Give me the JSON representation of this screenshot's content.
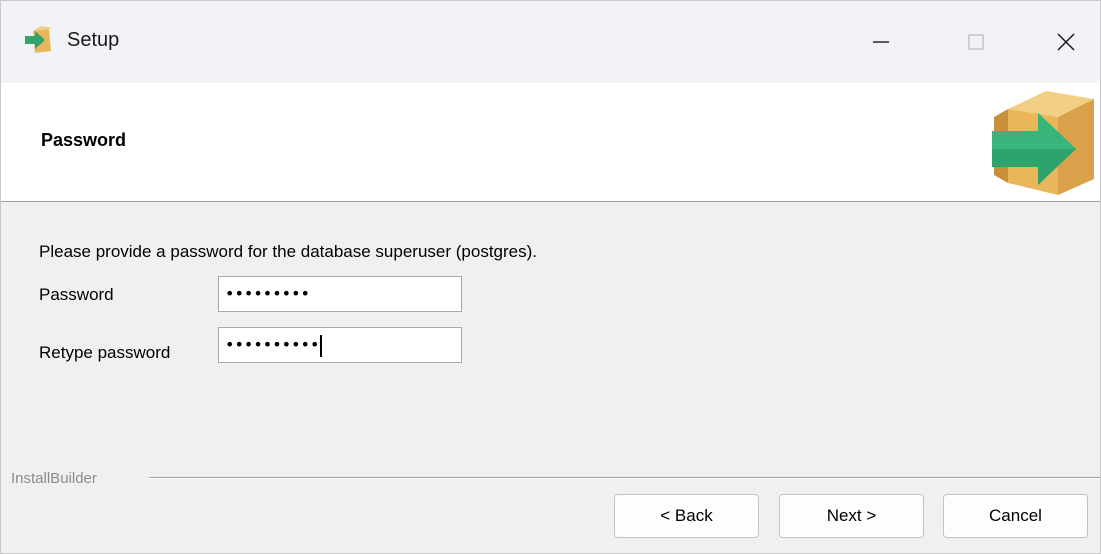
{
  "window": {
    "title": "Setup",
    "icon": "installer-box-arrow-icon",
    "controls": {
      "minimize": "minimize-icon",
      "maximize": "maximize-icon",
      "close": "close-icon"
    }
  },
  "header": {
    "title": "Password",
    "logo": "installer-box-arrow-icon"
  },
  "body": {
    "intro": "Please provide a password for the database superuser (postgres).",
    "password_label": "Password",
    "password_value": "•••••••••",
    "retype_label": "Retype password",
    "retype_value": "••••••••••"
  },
  "footer": {
    "brand": "InstallBuilder",
    "back_label": "< Back",
    "next_label": "Next >",
    "cancel_label": "Cancel"
  },
  "colors": {
    "arrow_green": "#2ea36b",
    "box_tan": "#e9b65a",
    "header_bg": "#ffffff",
    "window_bg": "#f0f0f0"
  }
}
